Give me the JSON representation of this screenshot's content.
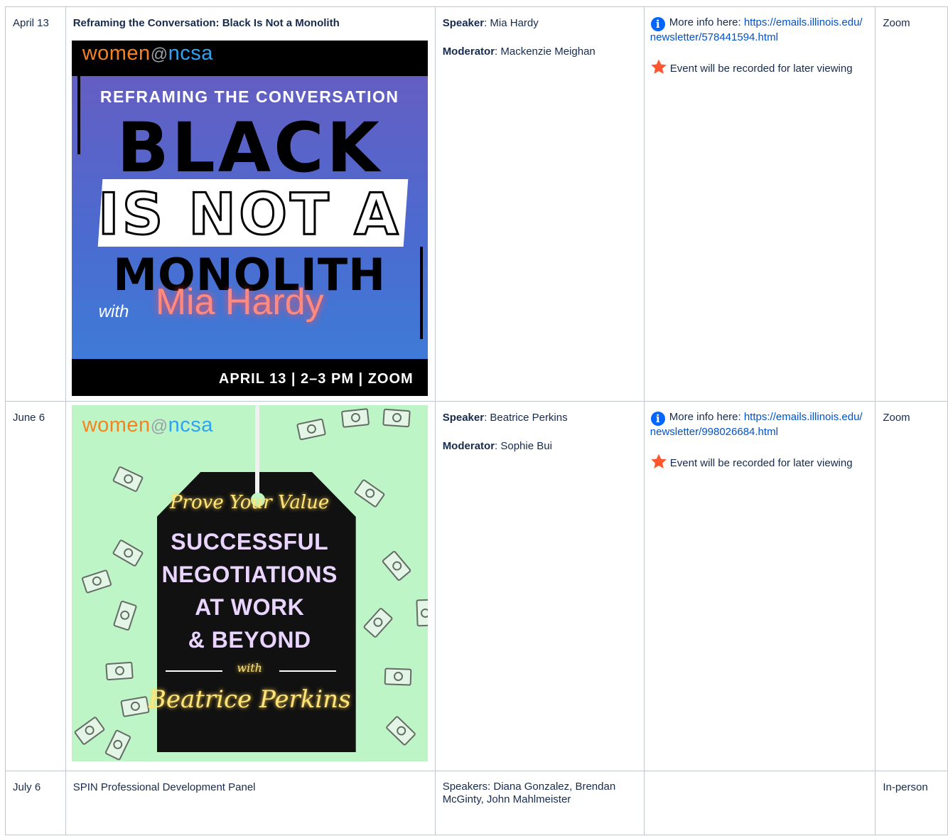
{
  "rows": [
    {
      "date": "April 13",
      "title": "Reframing the Conversation: Black Is Not a Monolith",
      "banner": {
        "logo_women": "women",
        "logo_at": "@",
        "logo_ncsa": "ncsa",
        "line1": "REFRAMING THE CONVERSATION",
        "line2": "BLACK",
        "line3": "IS NOT A",
        "line4": "MONOLITH",
        "with": "with",
        "name": "Mia Hardy",
        "date_line": "APRIL 13 | 2–3 PM | ZOOM"
      },
      "speaker_label": "Speaker",
      "speaker": ": Mia Hardy",
      "moderator_label": "Moderator",
      "moderator": ": Mackenzie Meighan",
      "info_prefix": "More info here: ",
      "info_link": "https://emails.illinois.edu/newsletter/578441594.html",
      "recorded": "Event will be recorded for later viewing",
      "location": "Zoom"
    },
    {
      "date": "June 6",
      "banner": {
        "logo_women": "women",
        "logo_at": "@",
        "logo_ncsa": "ncsa",
        "script1": "Prove Your Value",
        "w1": "SUCCESSFUL",
        "w2": "NEGOTIATIONS",
        "w3": "AT WORK",
        "w4": "& BEYOND",
        "with": "with",
        "script2": "Beatrice Perkins"
      },
      "speaker_label": "Speaker",
      "speaker": ": Beatrice Perkins",
      "moderator_label": "Moderator",
      "moderator": ": Sophie Bui",
      "info_prefix": "More info here: ",
      "info_link": "https://emails.illinois.edu/newsletter/998026684.html",
      "recorded": "Event will be recorded for later viewing",
      "location": "Zoom"
    },
    {
      "date": "July 6",
      "title": "SPIN Professional Development Panel",
      "speakers": "Speakers: Diana Gonzalez, Brendan McGinty, John Mahlmeister",
      "location": "In-person"
    }
  ],
  "colors": {
    "link": "#0052cc",
    "info_icon": "#0065ff",
    "star_icon": "#ff5630",
    "border": "#c1c7d0"
  },
  "icons": [
    "info-icon",
    "star-icon"
  ]
}
